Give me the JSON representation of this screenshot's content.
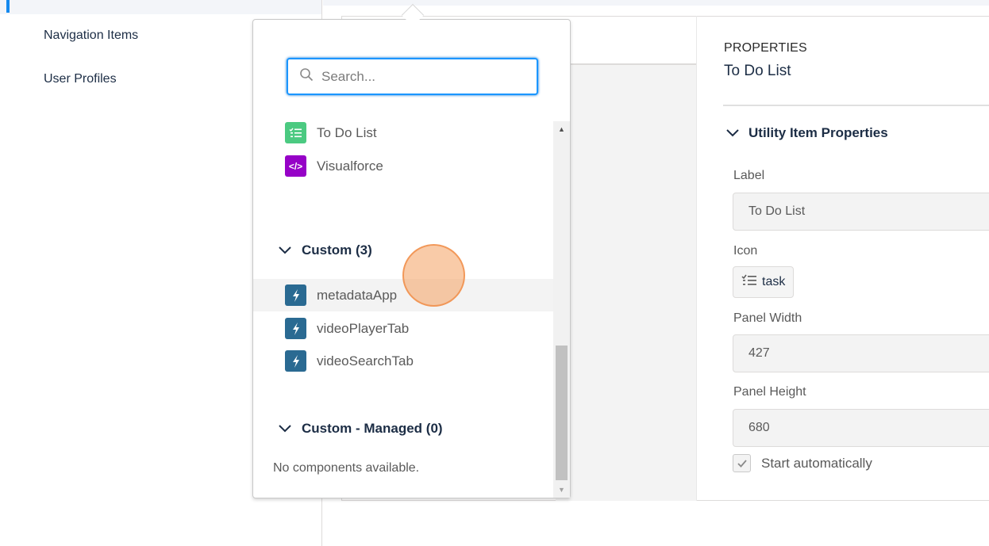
{
  "sidebar": {
    "items": [
      {
        "label": "Navigation Items"
      },
      {
        "label": "User Profiles"
      }
    ]
  },
  "popover": {
    "search": {
      "placeholder": "Search...",
      "value": ""
    },
    "standard_items": [
      {
        "label": "To Do List",
        "icon": "task-icon",
        "color": "#4bca81"
      },
      {
        "label": "Visualforce",
        "icon": "code-icon",
        "color": "#9602c7"
      }
    ],
    "groups": [
      {
        "title": "Custom (3)",
        "items": [
          {
            "label": "metadataApp",
            "icon": "lightning-icon",
            "color": "#2a6a92"
          },
          {
            "label": "videoPlayerTab",
            "icon": "lightning-icon",
            "color": "#2a6a92"
          },
          {
            "label": "videoSearchTab",
            "icon": "lightning-icon",
            "color": "#2a6a92"
          }
        ]
      },
      {
        "title": "Custom - Managed (0)",
        "empty_text": "No components available."
      }
    ]
  },
  "properties": {
    "eyebrow": "PROPERTIES",
    "title": "To Do List",
    "section_title": "Utility Item Properties",
    "fields": {
      "label": {
        "label": "Label",
        "value": "To Do List"
      },
      "icon": {
        "label": "Icon",
        "value": "task"
      },
      "panel_width": {
        "label": "Panel Width",
        "value": "427"
      },
      "panel_height": {
        "label": "Panel Height",
        "value": "680"
      }
    },
    "start_automatically": {
      "label": "Start automatically",
      "checked": true
    }
  },
  "colors": {
    "accent": "#1b96ff",
    "heading": "#1c2d45",
    "click_indicator": "#f4a060"
  }
}
